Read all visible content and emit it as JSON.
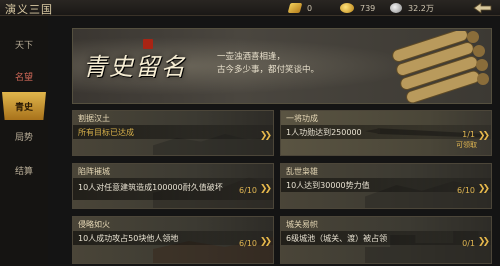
{
  "top": {
    "title": "演义三国",
    "resources": [
      {
        "icon": "gold-ingot-icon",
        "value": "0"
      },
      {
        "icon": "gold-coin-icon",
        "value": "739"
      },
      {
        "icon": "silver-coin-icon",
        "value": "32.2万"
      }
    ]
  },
  "sidebar": {
    "items": [
      {
        "label": "天下"
      },
      {
        "label": "名望"
      },
      {
        "label": "青史"
      },
      {
        "label": "局势"
      },
      {
        "label": "结算"
      }
    ],
    "active_index": 2
  },
  "banner": {
    "title": "青史留名",
    "poem_line1": "一壶浊酒喜相逢，",
    "poem_line2": "古今多少事，都付笑谈中。"
  },
  "tasks": [
    {
      "title": "割据汉土",
      "desc": "所有目标已达成",
      "progress": "",
      "claim": ""
    },
    {
      "title": "一将功成",
      "desc": "1人功勋达到250000",
      "progress": "1/1",
      "claim": "可领取"
    },
    {
      "title": "陷阵摧城",
      "desc": "10人对任意建筑造成100000耐久值破坏",
      "progress": "6/10",
      "claim": ""
    },
    {
      "title": "乱世枭雄",
      "desc": "10人达到30000势力值",
      "progress": "6/10",
      "claim": ""
    },
    {
      "title": "侵略如火",
      "desc": "10人成功攻占50块他人领地",
      "progress": "6/10",
      "claim": ""
    },
    {
      "title": "城关易帜",
      "desc": "6级城池（城关、渡）被占领",
      "progress": "0/1",
      "claim": ""
    }
  ],
  "colors": {
    "accent_gold": "#e0b652",
    "active_tab": "#d9a83a",
    "sidebar_red": "#d06858"
  }
}
